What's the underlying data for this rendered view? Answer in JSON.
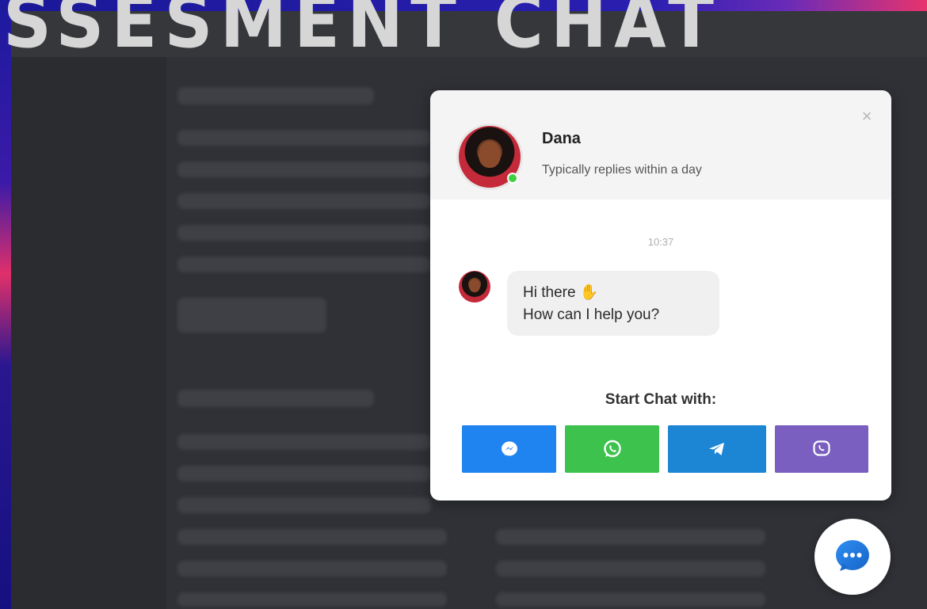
{
  "banner": {
    "title": "SSESMENT CHAT"
  },
  "chat": {
    "agent_name": "Dana",
    "agent_status": "Typically replies within a day",
    "close_label": "×",
    "timestamp": "10:37",
    "message_line1": "Hi there",
    "message_line2": "How can I help you?",
    "start_chat_label": "Start Chat with:",
    "channels": [
      "messenger-icon",
      "whatsapp-icon",
      "telegram-icon",
      "viber-icon"
    ]
  },
  "colors": {
    "messenger": "#1f83f0",
    "whatsapp": "#3ec24e",
    "telegram": "#1c86d4",
    "viber": "#7a5fc0",
    "online": "#3ecf3e"
  }
}
